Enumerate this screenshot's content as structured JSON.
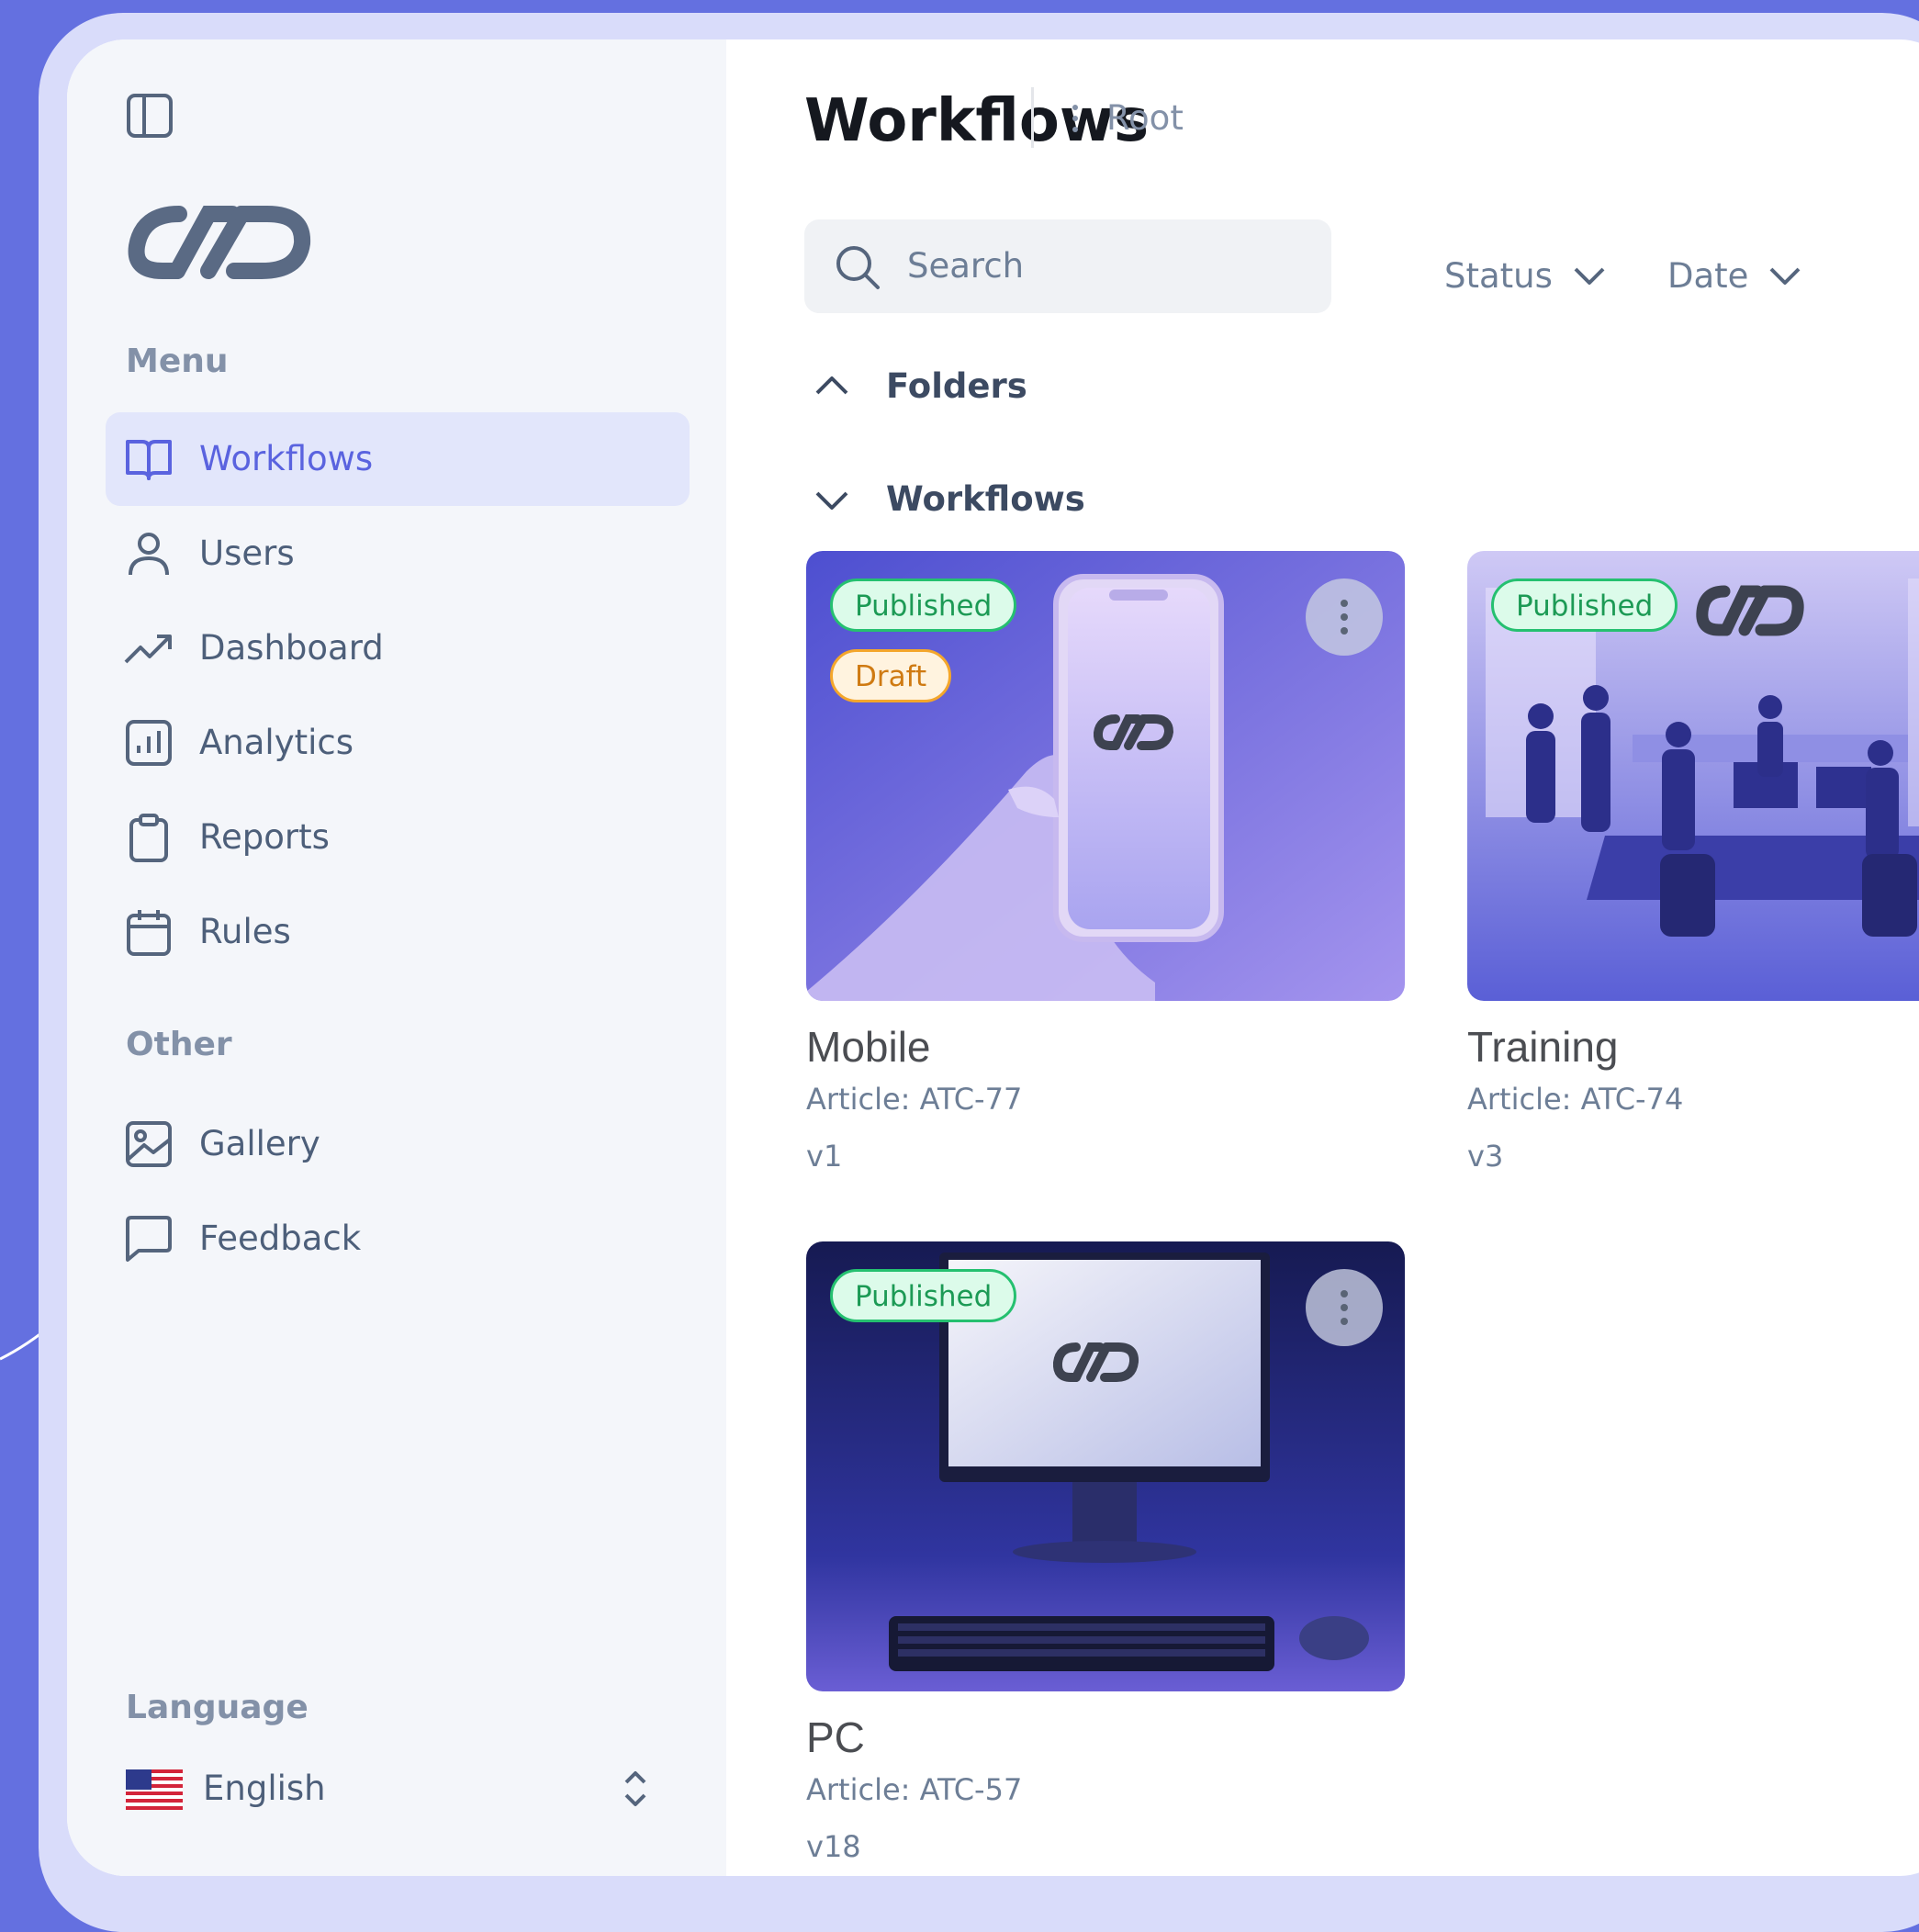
{
  "sidebar": {
    "menu_label": "Menu",
    "menu_items": [
      {
        "label": "Workflows",
        "icon": "book-open-icon",
        "active": true
      },
      {
        "label": "Users",
        "icon": "user-icon"
      },
      {
        "label": "Dashboard",
        "icon": "trending-up-icon"
      },
      {
        "label": "Analytics",
        "icon": "bar-chart-icon"
      },
      {
        "label": "Reports",
        "icon": "clipboard-icon"
      },
      {
        "label": "Rules",
        "icon": "calendar-icon"
      }
    ],
    "other_label": "Other",
    "other_items": [
      {
        "label": "Gallery",
        "icon": "image-icon"
      },
      {
        "label": "Feedback",
        "icon": "message-square-icon"
      }
    ],
    "language_label": "Language",
    "language_value": "English"
  },
  "header": {
    "title": "Workflows",
    "breadcrumb": "Root"
  },
  "toolbar": {
    "search_placeholder": "Search",
    "status_filter": "Status",
    "date_filter": "Date"
  },
  "sections": {
    "folders": "Folders",
    "workflows": "Workflows"
  },
  "cards": [
    {
      "title": "Mobile",
      "article": "Article: ATC-77",
      "version": "v1",
      "badges": [
        "Published",
        "Draft"
      ]
    },
    {
      "title": "Training",
      "article": "Article: ATC-74",
      "version": "v3",
      "badges": [
        "Published"
      ]
    },
    {
      "title": "PC",
      "article": "Article: ATC-57",
      "version": "v18",
      "badges": [
        "Published"
      ]
    }
  ],
  "colors": {
    "accent": "#5a63df",
    "background": "#6470e0",
    "published_green": "#1c9a55",
    "draft_orange": "#cf7a12"
  }
}
